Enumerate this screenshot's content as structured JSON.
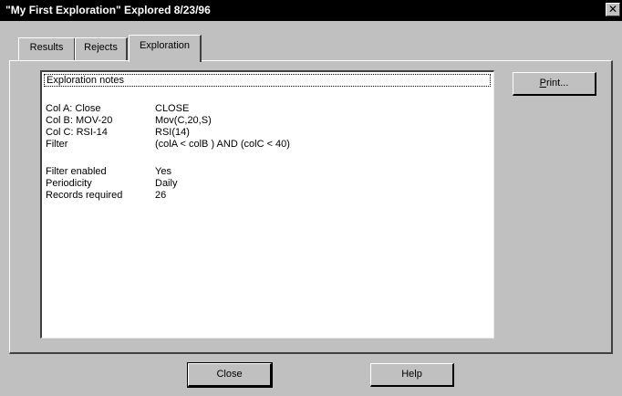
{
  "window": {
    "title": "\"My First Exploration\" Explored 8/23/96",
    "close_glyph": "✕"
  },
  "tabs": [
    {
      "label": "Results",
      "active": false
    },
    {
      "label": "Rejects",
      "active": false
    },
    {
      "label": "Exploration",
      "active": true
    }
  ],
  "notes": {
    "header": "Exploration notes",
    "rows": [
      {
        "key": "Col A: Close",
        "value": "CLOSE"
      },
      {
        "key": "Col B: MOV-20",
        "value": "Mov(C,20,S)"
      },
      {
        "key": "Col C: RSI-14",
        "value": "RSI(14)"
      },
      {
        "key": "Filter",
        "value": "(colA < colB ) AND (colC < 40)"
      },
      {
        "key": "Filter enabled",
        "value": "Yes"
      },
      {
        "key": "Periodicity",
        "value": "Daily"
      },
      {
        "key": "Records required",
        "value": "26"
      }
    ]
  },
  "buttons": {
    "print_mnemonic": "P",
    "print_rest": "rint...",
    "close": "Close",
    "help": "Help"
  }
}
